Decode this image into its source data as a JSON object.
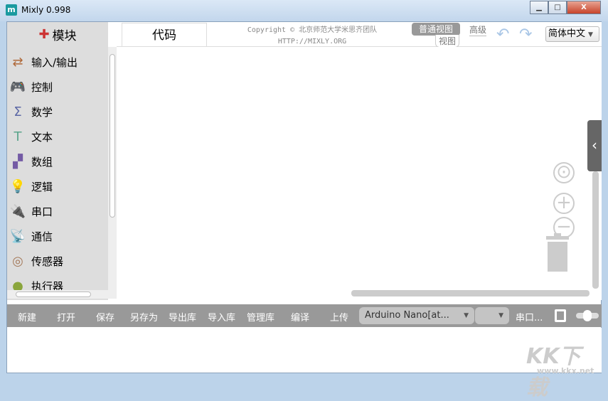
{
  "window": {
    "title": "Mixly 0.998",
    "app_icon": "m",
    "minimize": "▁",
    "maximize": "□",
    "close": "X"
  },
  "sidebar": {
    "header": "模块",
    "items": [
      {
        "label": "输入/输出",
        "icon": "⇄",
        "color": "#b06a3b"
      },
      {
        "label": "控制",
        "icon": "🎮",
        "color": "#5c9a5c"
      },
      {
        "label": "数学",
        "icon": "Σ",
        "color": "#5b67a5"
      },
      {
        "label": "文本",
        "icon": "T",
        "color": "#5ba58c"
      },
      {
        "label": "数组",
        "icon": "▞",
        "color": "#745ba5"
      },
      {
        "label": "逻辑",
        "icon": "💡",
        "color": "#5b80a5"
      },
      {
        "label": "串口",
        "icon": "🔌",
        "color": "#9a9a3c"
      },
      {
        "label": "通信",
        "icon": "📡",
        "color": "#5ba55b"
      },
      {
        "label": "传感器",
        "icon": "◎",
        "color": "#a57a5b"
      },
      {
        "label": "执行器",
        "icon": "●",
        "color": "#8aa53c"
      }
    ]
  },
  "tabs": {
    "code": "代码"
  },
  "header": {
    "copyright": "Copyright © 北京师范大学米思齐团队",
    "url": "HTTP://MIXLY.ORG",
    "view_normal": "普通视图",
    "view_label": "视图",
    "view_advanced": "高级",
    "language": "简体中文"
  },
  "workspace": {
    "flyout_toggle": "‹",
    "center": "⊙",
    "zoom_in": "+",
    "zoom_out": "−"
  },
  "toolbar": {
    "new": "新建",
    "open": "打开",
    "save": "保存",
    "save_as": "另存为",
    "export_lib": "导出库",
    "import_lib": "导入库",
    "manage_lib": "管理库",
    "compile": "编译",
    "upload": "上传",
    "board": "Arduino Nano[at...",
    "port": "",
    "serial": "串口..."
  },
  "watermark": {
    "text": "KK下载",
    "url": "www.kkx.net"
  }
}
